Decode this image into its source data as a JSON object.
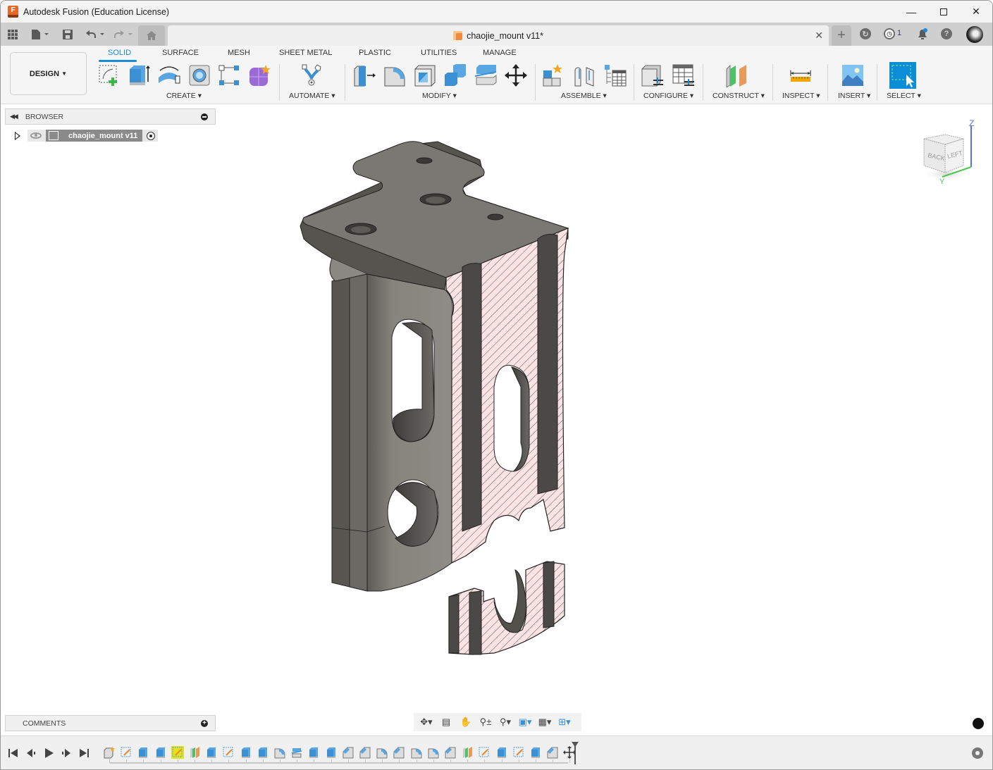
{
  "window": {
    "title": "Autodesk Fusion (Education License)",
    "logo_letter": "F",
    "controls": [
      "minimize",
      "maximize",
      "close"
    ]
  },
  "tabbar": {
    "document_tab": "chaojie_mount v11*",
    "job_count": "1",
    "icons": [
      "apps-grid-icon",
      "file-icon",
      "save-icon",
      "undo-icon",
      "redo-icon",
      "home-icon",
      "new-tab-icon",
      "offline-icon",
      "job-status-icon",
      "notifications-icon",
      "help-icon",
      "profile-avatar"
    ]
  },
  "ribbon": {
    "workspace": "DESIGN",
    "tabs": [
      {
        "label": "SOLID",
        "active": true
      },
      {
        "label": "SURFACE",
        "active": false
      },
      {
        "label": "MESH",
        "active": false
      },
      {
        "label": "SHEET METAL",
        "active": false
      },
      {
        "label": "PLASTIC",
        "active": false
      },
      {
        "label": "UTILITIES",
        "active": false
      },
      {
        "label": "MANAGE",
        "active": false
      }
    ],
    "groups": [
      {
        "label": "CREATE",
        "tools": [
          "create-sketch",
          "extrude",
          "revolve",
          "hole",
          "pattern",
          "create-form"
        ]
      },
      {
        "label": "AUTOMATE",
        "tools": [
          "automate"
        ]
      },
      {
        "label": "MODIFY",
        "tools": [
          "press-pull",
          "fillet",
          "shell",
          "combine",
          "split-body",
          "move-copy"
        ]
      },
      {
        "label": "ASSEMBLE",
        "tools": [
          "new-component",
          "joint",
          "bill-of-materials"
        ]
      },
      {
        "label": "CONFIGURE",
        "tools": [
          "configure-model",
          "configuration-table"
        ]
      },
      {
        "label": "CONSTRUCT",
        "tools": [
          "offset-plane"
        ]
      },
      {
        "label": "INSPECT",
        "tools": [
          "measure"
        ]
      },
      {
        "label": "INSERT",
        "tools": [
          "insert-image"
        ]
      },
      {
        "label": "SELECT",
        "tools": [
          "window-select"
        ]
      }
    ]
  },
  "browser": {
    "title": "BROWSER",
    "root_item": "chaojie_mount v11"
  },
  "viewcube": {
    "faces": [
      "BACK",
      "LEFT"
    ],
    "axes": [
      "Z",
      "Y"
    ]
  },
  "comments": {
    "title": "COMMENTS"
  },
  "navbar": {
    "tools": [
      "orbit",
      "look-at",
      "pan",
      "zoom",
      "fit",
      "display-settings",
      "grid-snaps",
      "viewports"
    ]
  },
  "timeline": {
    "controls": [
      "go-to-start",
      "step-back",
      "play",
      "step-forward",
      "go-to-end"
    ],
    "features": [
      "form",
      "sketch",
      "extrude",
      "extrude",
      "sketch-active",
      "plane",
      "extrude",
      "sketch",
      "extrude",
      "extrude",
      "fillet",
      "split",
      "extrude",
      "extrude",
      "chamfer",
      "chamfer",
      "fillet",
      "chamfer",
      "fillet",
      "fillet",
      "chamfer",
      "plane",
      "sketch",
      "extrude",
      "sketch",
      "extrude",
      "chamfer",
      "move"
    ],
    "active_index": 4
  },
  "colors": {
    "accent": "#1c8ad6",
    "section_hatch": "#fde3e3",
    "model_body": "#7d7b74",
    "timeline_highlight": "#e3e31a"
  }
}
